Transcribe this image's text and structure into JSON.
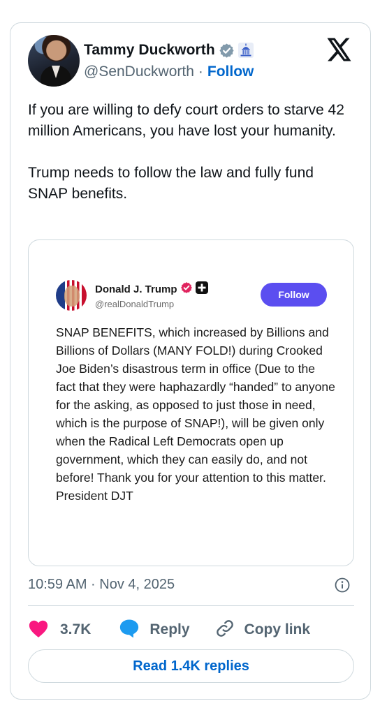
{
  "author": {
    "name": "Tammy Duckworth",
    "handle": "@SenDuckworth",
    "separator": "·",
    "follow_label": "Follow"
  },
  "tweet": {
    "text": "If you are willing to defy court orders to starve 42 million Americans, you have lost your humanity.\n\nTrump needs to follow the law and fully fund SNAP benefits."
  },
  "embedded": {
    "name": "Donald J. Trump",
    "handle": "@realDonaldTrump",
    "follow_label": "Follow",
    "text": "SNAP BENEFITS, which increased by Billions and Billions of Dollars (MANY FOLD!) during Crooked Joe Biden’s disastrous term in office (Due to the fact that they were haphazardly “handed” to anyone for the asking, as opposed to just those in need, which is the purpose of SNAP!), will be given only when the Radical Left Democrats open up government, which they can easily do, and not before! Thank you for your attention to this matter. President DJT"
  },
  "footer": {
    "timestamp": "10:59 AM · Nov 4, 2025",
    "likes": "3.7K",
    "reply_label": "Reply",
    "copy_label": "Copy link",
    "read_replies": "Read 1.4K replies"
  },
  "colors": {
    "accent": "#0066cc",
    "heart": "#f91880",
    "reply_bubble": "#1d9bf0",
    "truth_follow": "#5b4ef0",
    "verified_gray": "#829aab",
    "truth_verified": "#e0245e"
  },
  "icons": [
    "verified-badge-icon",
    "government-building-icon",
    "x-logo-icon",
    "info-icon",
    "heart-icon",
    "reply-bubble-icon",
    "link-icon",
    "truth-verified-icon",
    "truth-plus-icon"
  ]
}
